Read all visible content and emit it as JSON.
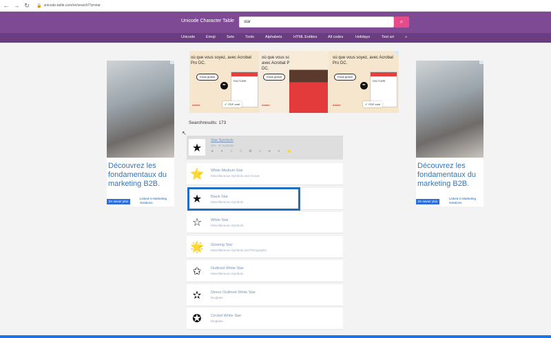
{
  "browser": {
    "url": "unicode-table.com/en/search/?q=star",
    "back_icon": "arrow-left-icon",
    "forward_icon": "arrow-right-icon",
    "reload_icon": "reload-icon",
    "lock_icon": "lock-icon"
  },
  "site": {
    "title": "Unicode Character Table",
    "search": {
      "value": "star",
      "button_icon": "search-icon"
    },
    "brand_color": "#7d4a93",
    "accent_color": "#e84b8a",
    "menu": [
      "Unicode",
      "Emoji",
      "Sets",
      "Tools",
      "Alphabets",
      "HTML Entities",
      "All codes",
      "Holidays",
      "Text art",
      "»"
    ]
  },
  "ads": {
    "side_text": "Découvrez les fondamentaux du marketing B2B.",
    "side_cta": "En savoir plus",
    "side_brand": "Linked in Marketing Solutions",
    "banner_text": "où que vous soyez, avec Acrobat Pro DC.",
    "banner_button": "Essai gratuit",
    "banner_doc_label": "FACTURE",
    "banner_pdf_label": "PDF créé",
    "banner_brand": "Adobe"
  },
  "results": {
    "count_label": "Searchresults: 173",
    "items": [
      {
        "glyph": "★",
        "name": "Star Symbols",
        "sub": "Set · 47 symbols",
        "selected": true
      },
      {
        "glyph": "⭐",
        "name": "White Medium Star",
        "sub": "Miscellaneous Symbols and Arrows"
      },
      {
        "glyph": "★",
        "name": "Black Star",
        "sub": "Miscellaneous Symbols"
      },
      {
        "glyph": "☆",
        "name": "White Star",
        "sub": "Miscellaneous Symbols"
      },
      {
        "glyph": "🌟",
        "name": "Glowing Star",
        "sub": "Miscellaneous Symbols and Pictographs"
      },
      {
        "glyph": "✩",
        "name": "Outlined White Star",
        "sub": "Miscellaneous Symbols"
      },
      {
        "glyph": "✫",
        "name": "Stress Outlined White Star",
        "sub": "Dingbats"
      },
      {
        "glyph": "✪",
        "name": "Circled White Star",
        "sub": "Dingbats"
      }
    ],
    "set_preview": "★ ✦ ✧ ✩ ✪ ✫ ✬ ✭ ⭐"
  },
  "highlight_color": "#1d6fc1"
}
